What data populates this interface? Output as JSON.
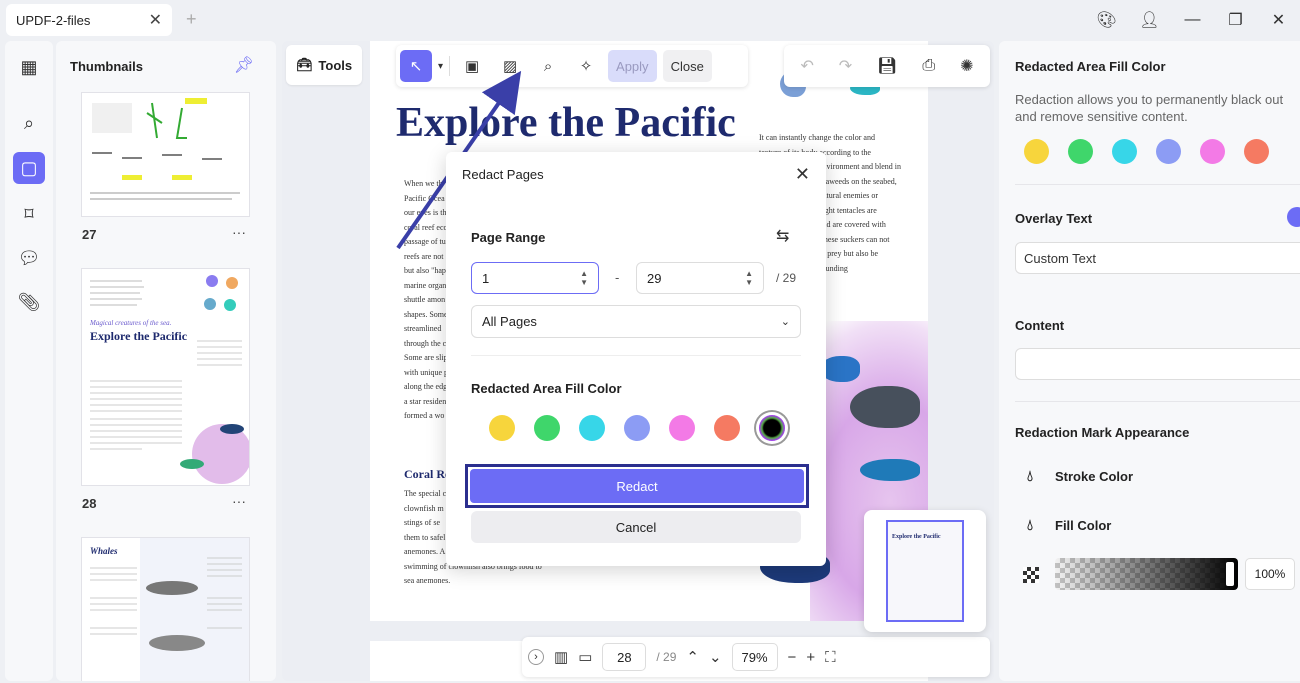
{
  "window": {
    "tab_title": "UPDF-2-files",
    "close_tab_icon": "close-icon",
    "new_tab_icon": "plus-icon",
    "controls": [
      "palette-icon",
      "user-icon",
      "minimize-icon",
      "restore-icon",
      "close-icon"
    ]
  },
  "sidebar": {
    "items": [
      {
        "icon": "grid-icon"
      },
      {
        "icon": "search-icon"
      },
      {
        "icon": "page-icon",
        "active": true
      },
      {
        "icon": "bookmark-icon"
      },
      {
        "icon": "comment-icon"
      },
      {
        "icon": "attachment-icon"
      }
    ]
  },
  "thumbnails": {
    "title": "Thumbnails",
    "pages": [
      {
        "number": "27"
      },
      {
        "number": "28",
        "heading": "Explore the Pacific",
        "caption": "Magical creatures of the sea."
      },
      {
        "number": "",
        "heading": "Whales"
      }
    ]
  },
  "tools": {
    "label": "Tools"
  },
  "toolbar": {
    "apply": "Apply",
    "close": "Close"
  },
  "document": {
    "title": "Explore the Pacific",
    "left_col": [
      "When we th",
      "Pacific Ocea",
      "our eyes is th",
      "coral reef eco",
      "passage of tu",
      "reefs are not",
      "but also \"hap",
      "marine organ",
      "shuttle amon",
      "shapes. Some",
      "streamlined",
      "through the c",
      "Some are slip",
      "with unique p",
      "along the edg",
      "a star residen",
      "formed a wo",
      "Coral Re"
    ],
    "right_col": [
      "It can instantly change the color and",
      "texture of its body according to the",
      "environment and blend in",
      "seaweeds on the seabed,",
      "natural enemies or",
      "eight tentacles are",
      "and are covered with",
      "These suckers can not",
      "ut prey but also be",
      "rounding"
    ],
    "subheading": "Coral Re",
    "bottom_text": [
      "The special c",
      "clownfish m",
      "stings of se",
      "them to safel",
      "anemones. A",
      "swimming of clownfish also brings food to",
      "sea anemones."
    ]
  },
  "dialog": {
    "title": "Redact Pages",
    "page_range_label": "Page Range",
    "from_value": "1",
    "to_value": "29",
    "separator": "-",
    "total": "/ 29",
    "range_option": "All Pages",
    "fill_color_label": "Redacted Area Fill Color",
    "colors": [
      "#f7d53c",
      "#3fd66b",
      "#37d6e8",
      "#8c9cf4",
      "#f37ae6",
      "#f57a62",
      "#000000"
    ],
    "redact_label": "Redact",
    "cancel_label": "Cancel"
  },
  "bottombar": {
    "page_input": "28",
    "page_total": "/ 29",
    "zoom": "79%"
  },
  "right_panel": {
    "fill_title": "Redacted Area Fill Color",
    "fill_desc": "Redaction allows you to permanently black out and remove sensitive content.",
    "colors": [
      "#f7d53c",
      "#3fd66b",
      "#37d6e8",
      "#8c9cf4",
      "#f37ae6",
      "#f57a62"
    ],
    "overlay_title": "Overlay Text",
    "overlay_value": "Custom Text",
    "content_title": "Content",
    "content_value": "",
    "appearance_title": "Redaction Mark Appearance",
    "stroke_label": "Stroke Color",
    "fill_label": "Fill Color",
    "opacity": "100%"
  },
  "colors": {
    "accent": "#6c6cf5",
    "title_blue": "#1e2a6e",
    "highlight_border": "#2b2f8e"
  }
}
